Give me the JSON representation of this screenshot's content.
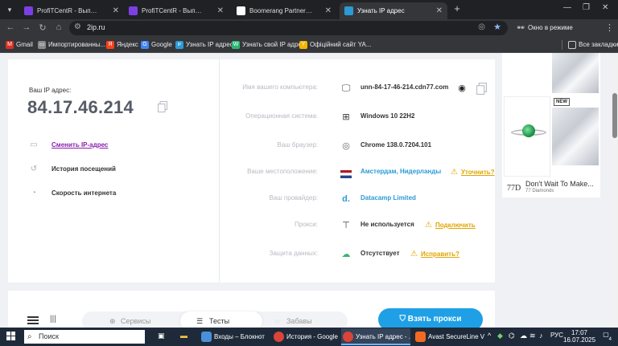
{
  "browser": {
    "tabs": [
      {
        "title": "ProfiTCentR - Выполнение зад",
        "favicon_color": "#7b3fe4"
      },
      {
        "title": "ProfiTCentR - Выполнение зад",
        "favicon_color": "#7b3fe4"
      },
      {
        "title": "Boomerang Partners and AC M",
        "favicon_color": "#1b1b1b"
      },
      {
        "title": "Узнать IP адрес",
        "favicon_color": "#2b9bd6",
        "active": true
      }
    ],
    "close_glyph": "✕",
    "new_tab_glyph": "+",
    "url": "2ip.ru",
    "incognito_label": "Окно в режиме инкогнито",
    "bookmarks": [
      {
        "label": "Gmail",
        "color": "#d93025",
        "glyph": "M"
      },
      {
        "label": "Импортированны...",
        "color": "#8a8a8a",
        "glyph": "▭"
      },
      {
        "label": "Яндекс",
        "color": "#fc3f1d",
        "glyph": "Я"
      },
      {
        "label": "Google",
        "color": "#4285f4",
        "glyph": "G"
      },
      {
        "label": "Узнать IP адрес",
        "color": "#2b9bd6",
        "glyph": "IP"
      },
      {
        "label": "Узнать свой IP адрес",
        "color": "#2bb673",
        "glyph": "W"
      },
      {
        "label": "Офіційний сайт YA...",
        "color": "#f5b400",
        "glyph": "Y"
      }
    ],
    "all_bookmarks": "Все закладки"
  },
  "ip_panel": {
    "label": "Ваш IP адрес:",
    "value": "84.17.46.214",
    "links": [
      {
        "label": "Сменить IP-адрес",
        "icon": "monitor-icon",
        "primary": true
      },
      {
        "label": "История посещений",
        "icon": "history-icon",
        "primary": false
      },
      {
        "label": "Скорость интернета",
        "icon": "speed-icon",
        "primary": false
      }
    ]
  },
  "info_rows": [
    {
      "key": "computer",
      "label": "Имя вашего компьютера:",
      "icon": "monitor-icon",
      "value": "unn-84-17-46-214.cdn77.com",
      "link": false
    },
    {
      "key": "os",
      "label": "Операционная система:",
      "icon": "windows-icon",
      "value": "Windows 10 22H2",
      "link": false
    },
    {
      "key": "browser",
      "label": "Ваш браузер:",
      "icon": "chrome-icon",
      "value": "Chrome 138.0.7204.101",
      "link": false
    },
    {
      "key": "location",
      "label": "Ваше местоположение:",
      "icon": "netherlands-flag-icon",
      "value": "Амстердам, Нидерланды",
      "link": true,
      "action": "Уточнить?"
    },
    {
      "key": "provider",
      "label": "Ваш провайдер:",
      "icon": "datacamp-icon",
      "value": "Datacamp Limited",
      "link": true
    },
    {
      "key": "proxy",
      "label": "Прокси:",
      "icon": "proxy-icon",
      "value": "Не используется",
      "link": false,
      "action": "Подключить"
    },
    {
      "key": "protection",
      "label": "Защита данных:",
      "icon": "cloud-lock-icon",
      "value": "Отсутствует",
      "link": false,
      "action": "Исправить?"
    }
  ],
  "bottom_nav": {
    "tabs": [
      {
        "label": "Сервисы",
        "active": false
      },
      {
        "label": "Тесты",
        "active": true
      },
      {
        "label": "Забавы",
        "active": false
      }
    ],
    "cta": "Взять прокси"
  },
  "ad": {
    "badge": "NEW",
    "logo": "77D",
    "title": "Don't Wait To Make...",
    "subtitle": "77 Diamonds"
  },
  "taskbar": {
    "search_placeholder": "Поиск",
    "apps": [
      {
        "label": "Входы – Блокнот",
        "color": "#4a90d9"
      },
      {
        "label": "История - Google ...",
        "color": "#db4437"
      },
      {
        "label": "Узнать IP адрес - ...",
        "color": "#db4437",
        "active": true
      },
      {
        "label": "Avast SecureLine V...",
        "color": "#f26a21"
      }
    ],
    "lang": "РУС",
    "time": "17:07",
    "date": "16.07.2025",
    "notifications": "4"
  }
}
